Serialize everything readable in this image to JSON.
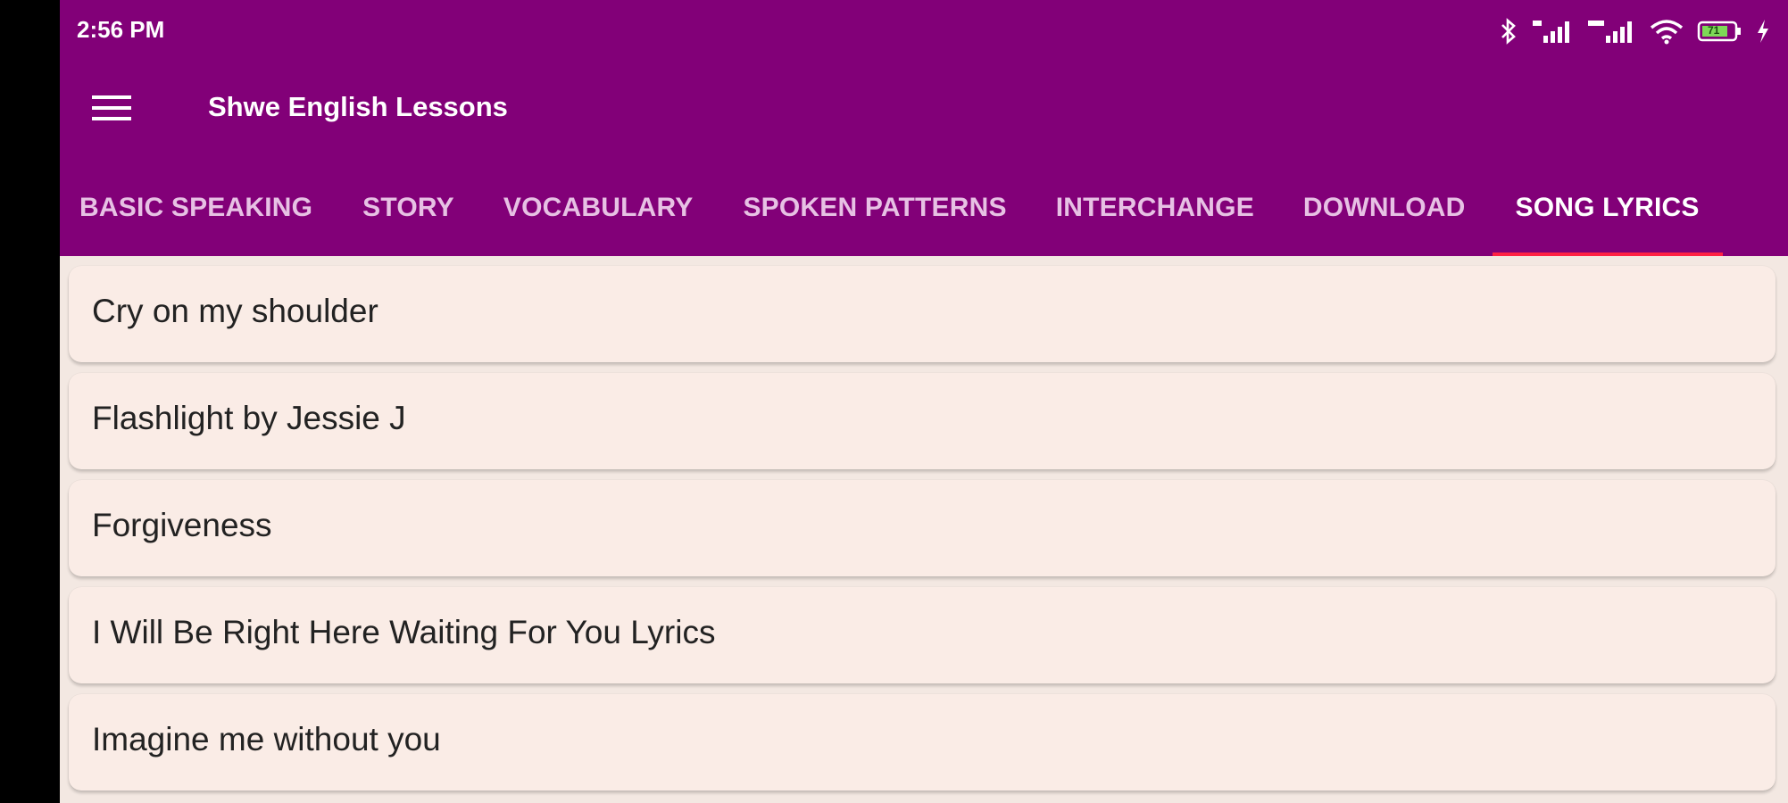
{
  "status_bar": {
    "time": "2:56 PM",
    "battery_level": "71",
    "icons": [
      "bluetooth-icon",
      "signal-4g-icon",
      "signal-icon",
      "wifi-icon",
      "battery-icon",
      "charging-icon"
    ]
  },
  "app_bar": {
    "title": "Shwe English Lessons",
    "menu_icon": "hamburger-menu-icon",
    "background_color": "#820078"
  },
  "tabs": [
    {
      "label": "BASIC SPEAKING",
      "active": false
    },
    {
      "label": "STORY",
      "active": false
    },
    {
      "label": "VOCABULARY",
      "active": false
    },
    {
      "label": "SPOKEN PATTERNS",
      "active": false
    },
    {
      "label": "INTERCHANGE",
      "active": false
    },
    {
      "label": "DOWNLOAD",
      "active": false
    },
    {
      "label": "SONG LYRICS",
      "active": true
    }
  ],
  "active_tab_indicator_color": "#ff2244",
  "song_list": [
    {
      "title": "Cry on my shoulder"
    },
    {
      "title": "Flashlight by Jessie J"
    },
    {
      "title": "Forgiveness"
    },
    {
      "title": "I Will Be Right Here Waiting For You Lyrics"
    },
    {
      "title": "Imagine me without you"
    }
  ]
}
